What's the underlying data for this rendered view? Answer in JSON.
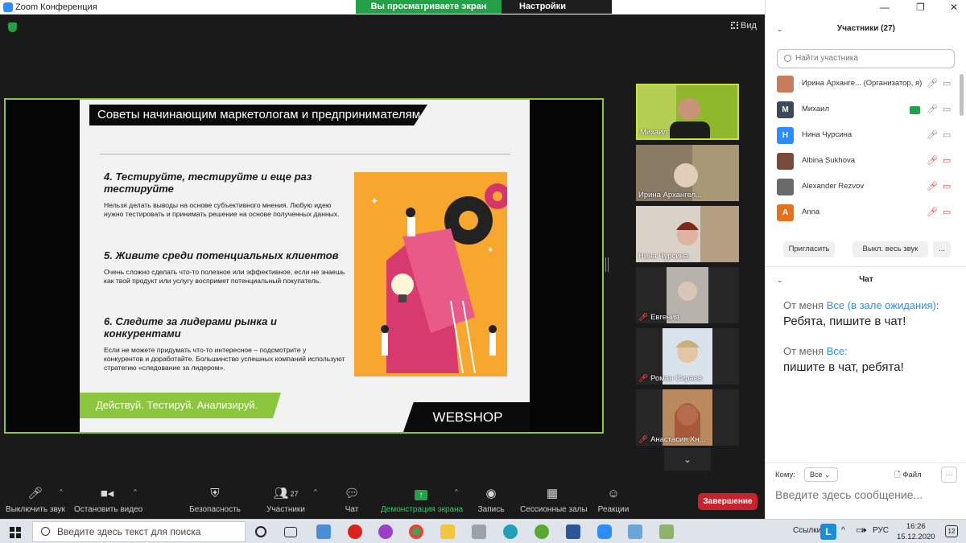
{
  "window": {
    "title": "Zoom Конференция",
    "share_banner": "Вы просматриваете экран Михаил",
    "view_settings": "Настройки просмотра",
    "view_label": "Вид"
  },
  "slide": {
    "title": "Советы начинающим маркетологам и предпринимателям",
    "tips": [
      {
        "heading": "4. Тестируйте, тестируйте и еще раз тестируйте",
        "text": "Нельзя делать выводы на основе субъективного мнения. Любую идею нужно тестировать и принимать решение на основе полученных данных."
      },
      {
        "heading": "5. Живите среди потенциальных клиентов",
        "text": "Очень сложно сделать что-то полезное или эффективное, если не знаешь как твой продукт или услугу воспримет потенциальный покупатель."
      },
      {
        "heading": "6. Следите за лидерами рынка и конкурентами",
        "text": "Если не можете придумать что-то интересное – подсмотрите у конкурентов и доработайте. Большинство успешных компаний используют стратегию «следование за лидером»."
      }
    ],
    "motto": "Действуй. Тестируй. Анализируй.",
    "brand": "WEBSHOP"
  },
  "thumbnails": [
    {
      "name": "Михаил",
      "muted": false,
      "active": true
    },
    {
      "name": "Ирина Архангел...",
      "muted": false,
      "active": false
    },
    {
      "name": "Нина Чурсина",
      "muted": false,
      "active": false
    },
    {
      "name": "Евгения",
      "muted": true,
      "active": false
    },
    {
      "name": "Роман Сираев",
      "muted": true,
      "active": false
    },
    {
      "name": "Анастасия Хн...",
      "muted": true,
      "active": false
    }
  ],
  "controls": {
    "mute": "Выключить звук",
    "video": "Остановить видео",
    "security": "Безопасность",
    "participants": "Участники",
    "participants_count": "27",
    "chat": "Чат",
    "share": "Демонстрация экрана",
    "record": "Запись",
    "breakout": "Сессионные залы",
    "reactions": "Реакции",
    "end": "Завершение"
  },
  "participants_panel": {
    "header": "Участники (27)",
    "search_placeholder": "Найти участника",
    "list": [
      {
        "name": "Ирина Архангe... (Организатор, я)",
        "avatar": "",
        "color": "#c97b5a",
        "mic": "on",
        "cam": "on",
        "sharing": false
      },
      {
        "name": "Михаил",
        "avatar": "М",
        "color": "#3a4a5c",
        "mic": "on",
        "cam": "on",
        "sharing": true
      },
      {
        "name": "Нина Чурсина",
        "avatar": "Н",
        "color": "#2D8CFF",
        "mic": "on",
        "cam": "on",
        "sharing": false
      },
      {
        "name": "Albina Sukhova",
        "avatar": "",
        "color": "#7a4a3a",
        "mic": "off",
        "cam": "off",
        "sharing": false
      },
      {
        "name": "Alexander Rezvov",
        "avatar": "",
        "color": "#6a6a6a",
        "mic": "off",
        "cam": "off",
        "sharing": false
      },
      {
        "name": "Anna",
        "avatar": "A",
        "color": "#e8701a",
        "mic": "off",
        "cam": "off",
        "sharing": false
      }
    ],
    "invite": "Пригласить",
    "mute_all": "Выкл. весь звук",
    "more": "..."
  },
  "chat": {
    "header": "Чат",
    "messages": [
      {
        "from": "От меня",
        "to": "Все (в зале ожидания):",
        "text": "Ребята, пишите в чат!"
      },
      {
        "from": "От меня",
        "to": "Все:",
        "text": "пишите в чат, ребята!"
      }
    ],
    "to_label": "Кому:",
    "to_value": "Все",
    "file": "Файл",
    "more": "···",
    "input_placeholder": "Введите здесь сообщение..."
  },
  "taskbar": {
    "search_placeholder": "Введите здесь текст для поиска",
    "links": "Ссылки",
    "lang": "РУС",
    "time": "16:26",
    "date": "15.12.2020",
    "notifications": "12"
  },
  "colors": {
    "accent": "#2D8CFF",
    "share_green": "#24a148",
    "end_red": "#c8232c",
    "slide_green": "#8cc63f"
  }
}
